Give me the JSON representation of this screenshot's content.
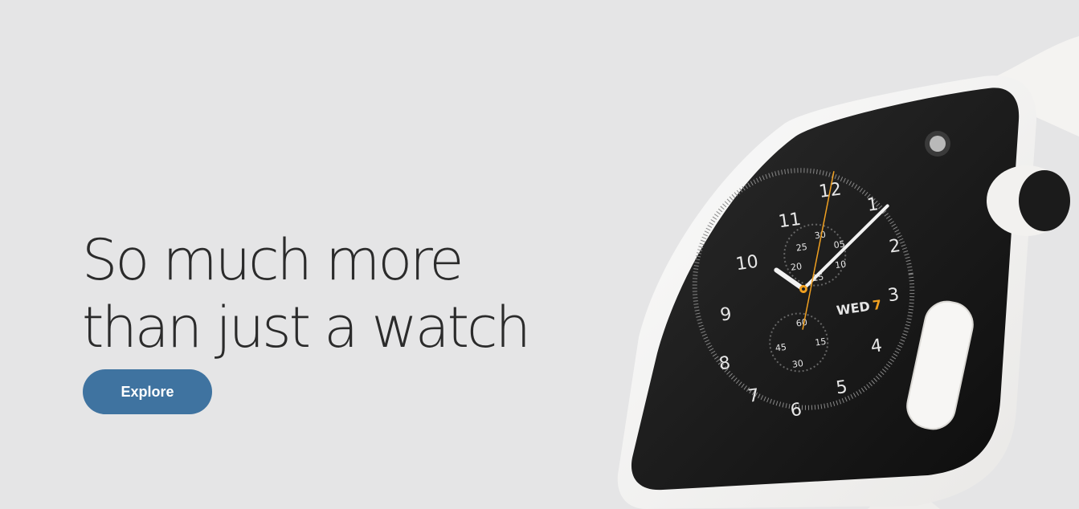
{
  "hero": {
    "headline_line1": "So much more",
    "headline_line2": "than just a watch",
    "explore_label": "Explore"
  },
  "watch_face": {
    "hour_numerals": [
      "12",
      "1",
      "2",
      "3",
      "4",
      "5",
      "6",
      "7",
      "8",
      "9",
      "10",
      "11"
    ],
    "date_day": "WED",
    "date_num": "7",
    "top_subdial": [
      "30",
      "05",
      "25",
      "10",
      "20",
      "15"
    ],
    "bottom_subdial": [
      "60",
      "15",
      "45",
      "30"
    ]
  },
  "colors": {
    "background": "#e5e5e6",
    "headline": "#2b2b2b",
    "button": "#3f73a0",
    "button_text": "#ffffff",
    "accent_orange": "#f0a020"
  }
}
